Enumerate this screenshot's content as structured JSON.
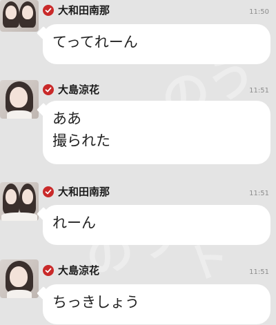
{
  "theme": {
    "background": "#e4e4e4",
    "bubble": "#ffffff",
    "verified": "#c92a2a"
  },
  "messages": [
    {
      "sender": "大和田南那",
      "time": "11:50",
      "text": "てってれーん"
    },
    {
      "sender": "大島涼花",
      "time": "11:51",
      "text": "ああ\n撮られた"
    },
    {
      "sender": "大和田南那",
      "time": "11:51",
      "text": "れーん"
    },
    {
      "sender": "大島涼花",
      "time": "11:51",
      "text": "ちっきしょう"
    }
  ]
}
